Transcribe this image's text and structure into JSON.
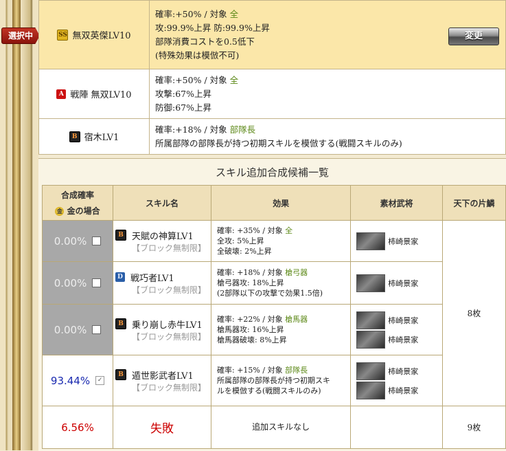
{
  "selected_tag": "選択中",
  "change_button": "変更",
  "slots": [
    {
      "badge": "SS",
      "name": "無双英傑LV10",
      "lines": [
        {
          "a": "確率:+50% /  対象 ",
          "g": "全"
        },
        {
          "a": "攻:99.9%上昇  防:99.9%上昇",
          "g": ""
        },
        {
          "a": "部隊消費コストを0.5低下",
          "g": ""
        },
        {
          "a": "(特殊効果は模倣不可)",
          "g": ""
        }
      ]
    },
    {
      "badge": "A",
      "name": "戦陣 無双LV10",
      "lines": [
        {
          "a": "確率:+50% /  対象 ",
          "g": "全"
        },
        {
          "a": "攻撃:67%上昇",
          "g": ""
        },
        {
          "a": "防御:67%上昇",
          "g": ""
        }
      ]
    },
    {
      "badge": "B",
      "name": "宿木LV1",
      "lines": [
        {
          "a": "確率:+18% /  対象 ",
          "g": "部隊長"
        },
        {
          "a": "所属部隊の部隊長が持つ初期スキルを模倣する(戦闘スキルのみ)",
          "g": ""
        }
      ]
    }
  ],
  "candidates": {
    "title": "スキル追加合成候補一覧",
    "headers": {
      "rate": "合成確率",
      "rate_sub": "金の場合",
      "coin": "金",
      "skill": "スキル名",
      "effect": "効果",
      "material": "素材武将",
      "tenka": "天下の片鱗"
    },
    "rows": [
      {
        "rate": "0.00%",
        "badge": "B",
        "name": "天賦の神算LV1",
        "sub": "【ブロック無制限】",
        "effect": [
          {
            "a": "確率: +35% /  対象 ",
            "g": "全"
          },
          {
            "a": "全攻: 5%上昇",
            "g": ""
          },
          {
            "a": "全破壊: 2%上昇",
            "g": ""
          }
        ],
        "materials": [
          "柿崎景家"
        ]
      },
      {
        "rate": "0.00%",
        "badge": "D",
        "name": "戦巧者LV1",
        "sub": "【ブロック無制限】",
        "effect": [
          {
            "a": "確率: +18% /  対象 ",
            "g": "槍弓器"
          },
          {
            "a": "槍弓器攻: 18%上昇",
            "g": ""
          },
          {
            "a": "(2部隊以下の攻撃で効果1.5倍)",
            "g": ""
          }
        ],
        "materials": [
          "柿崎景家"
        ]
      },
      {
        "rate": "0.00%",
        "badge": "B",
        "name": "乗り崩し赤牛LV1",
        "sub": "【ブロック無制限】",
        "effect": [
          {
            "a": "確率: +22% /  対象 ",
            "g": "槍馬器"
          },
          {
            "a": "槍馬器攻: 16%上昇",
            "g": ""
          },
          {
            "a": "槍馬器破壊: 8%上昇",
            "g": ""
          }
        ],
        "materials": [
          "柿崎景家",
          "柿崎景家"
        ]
      },
      {
        "rate": "93.44%",
        "badge": "B",
        "name": "遁世影武者LV1",
        "sub": "【ブロック無制限】",
        "effect": [
          {
            "a": "確率: +15% /  対象 ",
            "g": "部隊長"
          },
          {
            "a": "所属部隊の部隊長が持つ初期スキ",
            "g": ""
          },
          {
            "a": "ルを模倣する(戦闘スキルのみ)",
            "g": ""
          }
        ],
        "materials": [
          "柿崎景家",
          "柿崎景家"
        ]
      }
    ],
    "tenka_top": "8枚",
    "fail_row": {
      "rate": "6.56%",
      "name": "失敗",
      "effect": "追加スキルなし",
      "tenka": "9枚"
    }
  }
}
